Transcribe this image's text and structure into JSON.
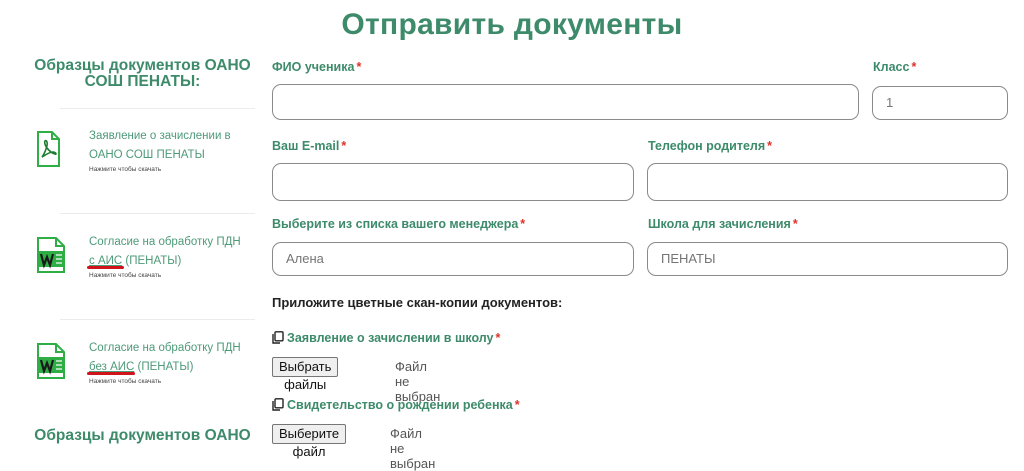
{
  "page": {
    "title": "Отправить документы"
  },
  "sidebar": {
    "heading": "Образцы документов ОАНО СОШ ПЕНАТЫ:",
    "heading_bottom": "Образцы документов ОАНО",
    "items": [
      {
        "icon": "pdf-icon",
        "text": "Заявление о зачислении в ОАНО СОШ ПЕНАТЫ",
        "hint": "Нажмите чтобы скачать"
      },
      {
        "icon": "word-doc-icon",
        "text_before": "Согласие на обработку ПДН",
        "link": "с АИС",
        "text_after": "(ПЕНАТЫ)",
        "hint": "Нажмите чтобы скачать"
      },
      {
        "icon": "word-doc-icon",
        "text_before": "Согласие на обработку ПДН",
        "link": "без АИС",
        "text_after": "(ПЕНАТЫ)",
        "hint": "Нажмите чтобы скачать"
      }
    ]
  },
  "form": {
    "fio_label": "ФИО ученика",
    "class_label": "Класс",
    "class_placeholder": "1",
    "email_label": "Ваш E-mail",
    "phone_label": "Телефон родителя",
    "manager_label": "Выберите из списка вашего менеджера",
    "manager_placeholder": "Алена",
    "school_label": "Школа для зачисления",
    "school_placeholder": "ПЕНАТЫ",
    "required_mark": "*",
    "attach_text": "Приложите цветные скан-копии документов:",
    "file1_label": "Заявление о зачислении в школу",
    "file1_button": "Выбрать файлы",
    "file1_status": "Файл не выбран",
    "file2_label": "Свидетельство о рождении ребенка",
    "file2_button": "Выберите файл",
    "file2_status": "Файл не выбран"
  },
  "colors": {
    "accent": "#3d8b6a",
    "required": "#e0302a",
    "underline_mark": "#d1141b"
  }
}
